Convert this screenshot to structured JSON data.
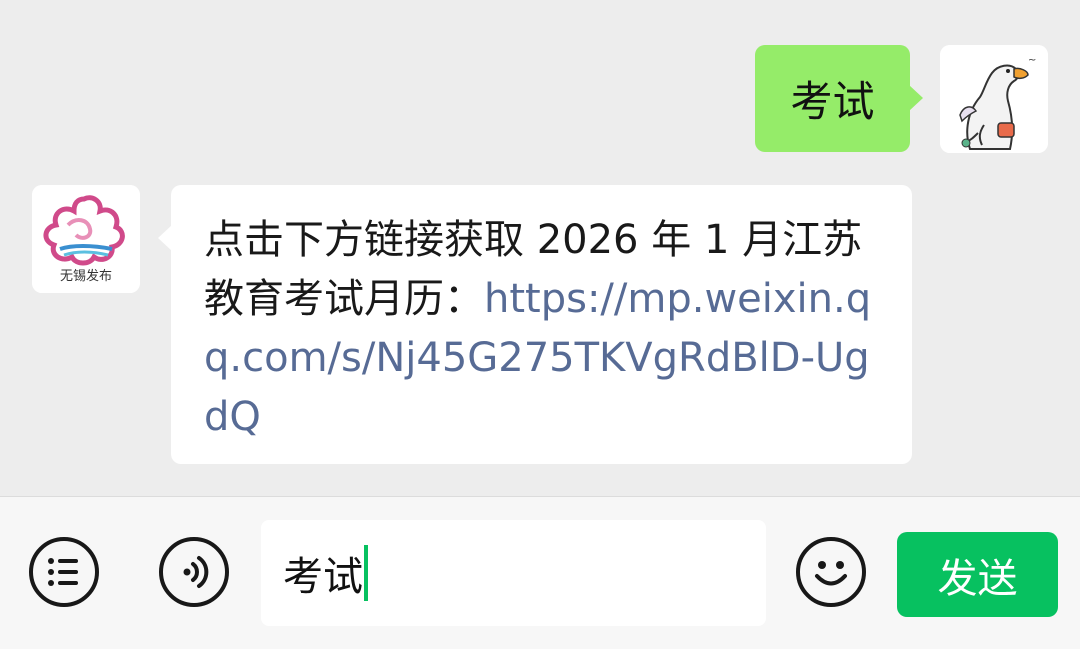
{
  "colors": {
    "chat_background": "#ededed",
    "outgoing_bubble": "#95ec69",
    "incoming_bubble": "#ffffff",
    "link": "#576b95",
    "send_button": "#07c160",
    "caret": "#07c160"
  },
  "messages": [
    {
      "direction": "outgoing",
      "avatar_icon": "cartoon-goose-avatar",
      "text": "考试"
    },
    {
      "direction": "incoming",
      "sender_logo_text": "无锡发布",
      "avatar_icon": "wuxi-fabu-logo",
      "text": "点击下方链接获取 2026 年 1 月江苏教育考试月历：",
      "link": "https://mp.weixin.qq.com/s/Nj45G275TKVgRdBlD-UgdQ"
    }
  ],
  "input_bar": {
    "menu_icon": "list-menu-icon",
    "voice_icon": "voice-icon",
    "text_value": "考试",
    "emoji_icon": "emoji-icon",
    "send_label": "发送"
  }
}
